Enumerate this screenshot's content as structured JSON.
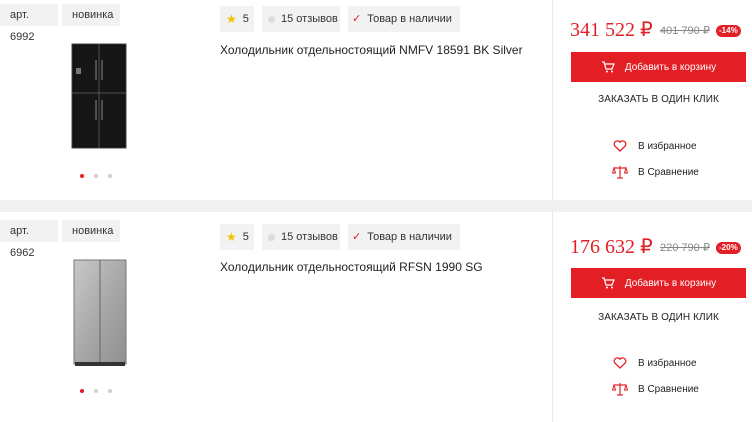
{
  "products": [
    {
      "article": "арт. 6992",
      "badge": "новинка",
      "rating": "5",
      "reviews": "15 отзывов",
      "stock": "Товар в наличии",
      "title": "Холодильник отдельностоящий NMFV 18591 BK Silver",
      "price": "341 522 ₽",
      "old_price": "401 790 ₽",
      "discount": "-14%",
      "cart_label": "Добавить в корзину",
      "one_click": "ЗАКАЗАТЬ В ОДИН КЛИК",
      "favorite": "В избранное",
      "compare": "В Сравнение",
      "image_icon": "fridge-black-4door"
    },
    {
      "article": "арт. 6962",
      "badge": "новинка",
      "rating": "5",
      "reviews": "15 отзывов",
      "stock": "Товар в наличии",
      "title": "Холодильник отдельностоящий RFSN 1990 SG",
      "price": "176 632 ₽",
      "old_price": "220 790 ₽",
      "discount": "-20%",
      "cart_label": "Добавить в корзину",
      "one_click": "ЗАКАЗАТЬ В ОДИН КЛИК",
      "favorite": "В избранное",
      "compare": "В Сравнение",
      "image_icon": "fridge-silver-side-by-side"
    }
  ],
  "colors": {
    "accent": "#e31e24",
    "star": "#f2c400",
    "chip_bg": "#f2f2f2",
    "page_bg": "#f0f0f0"
  }
}
